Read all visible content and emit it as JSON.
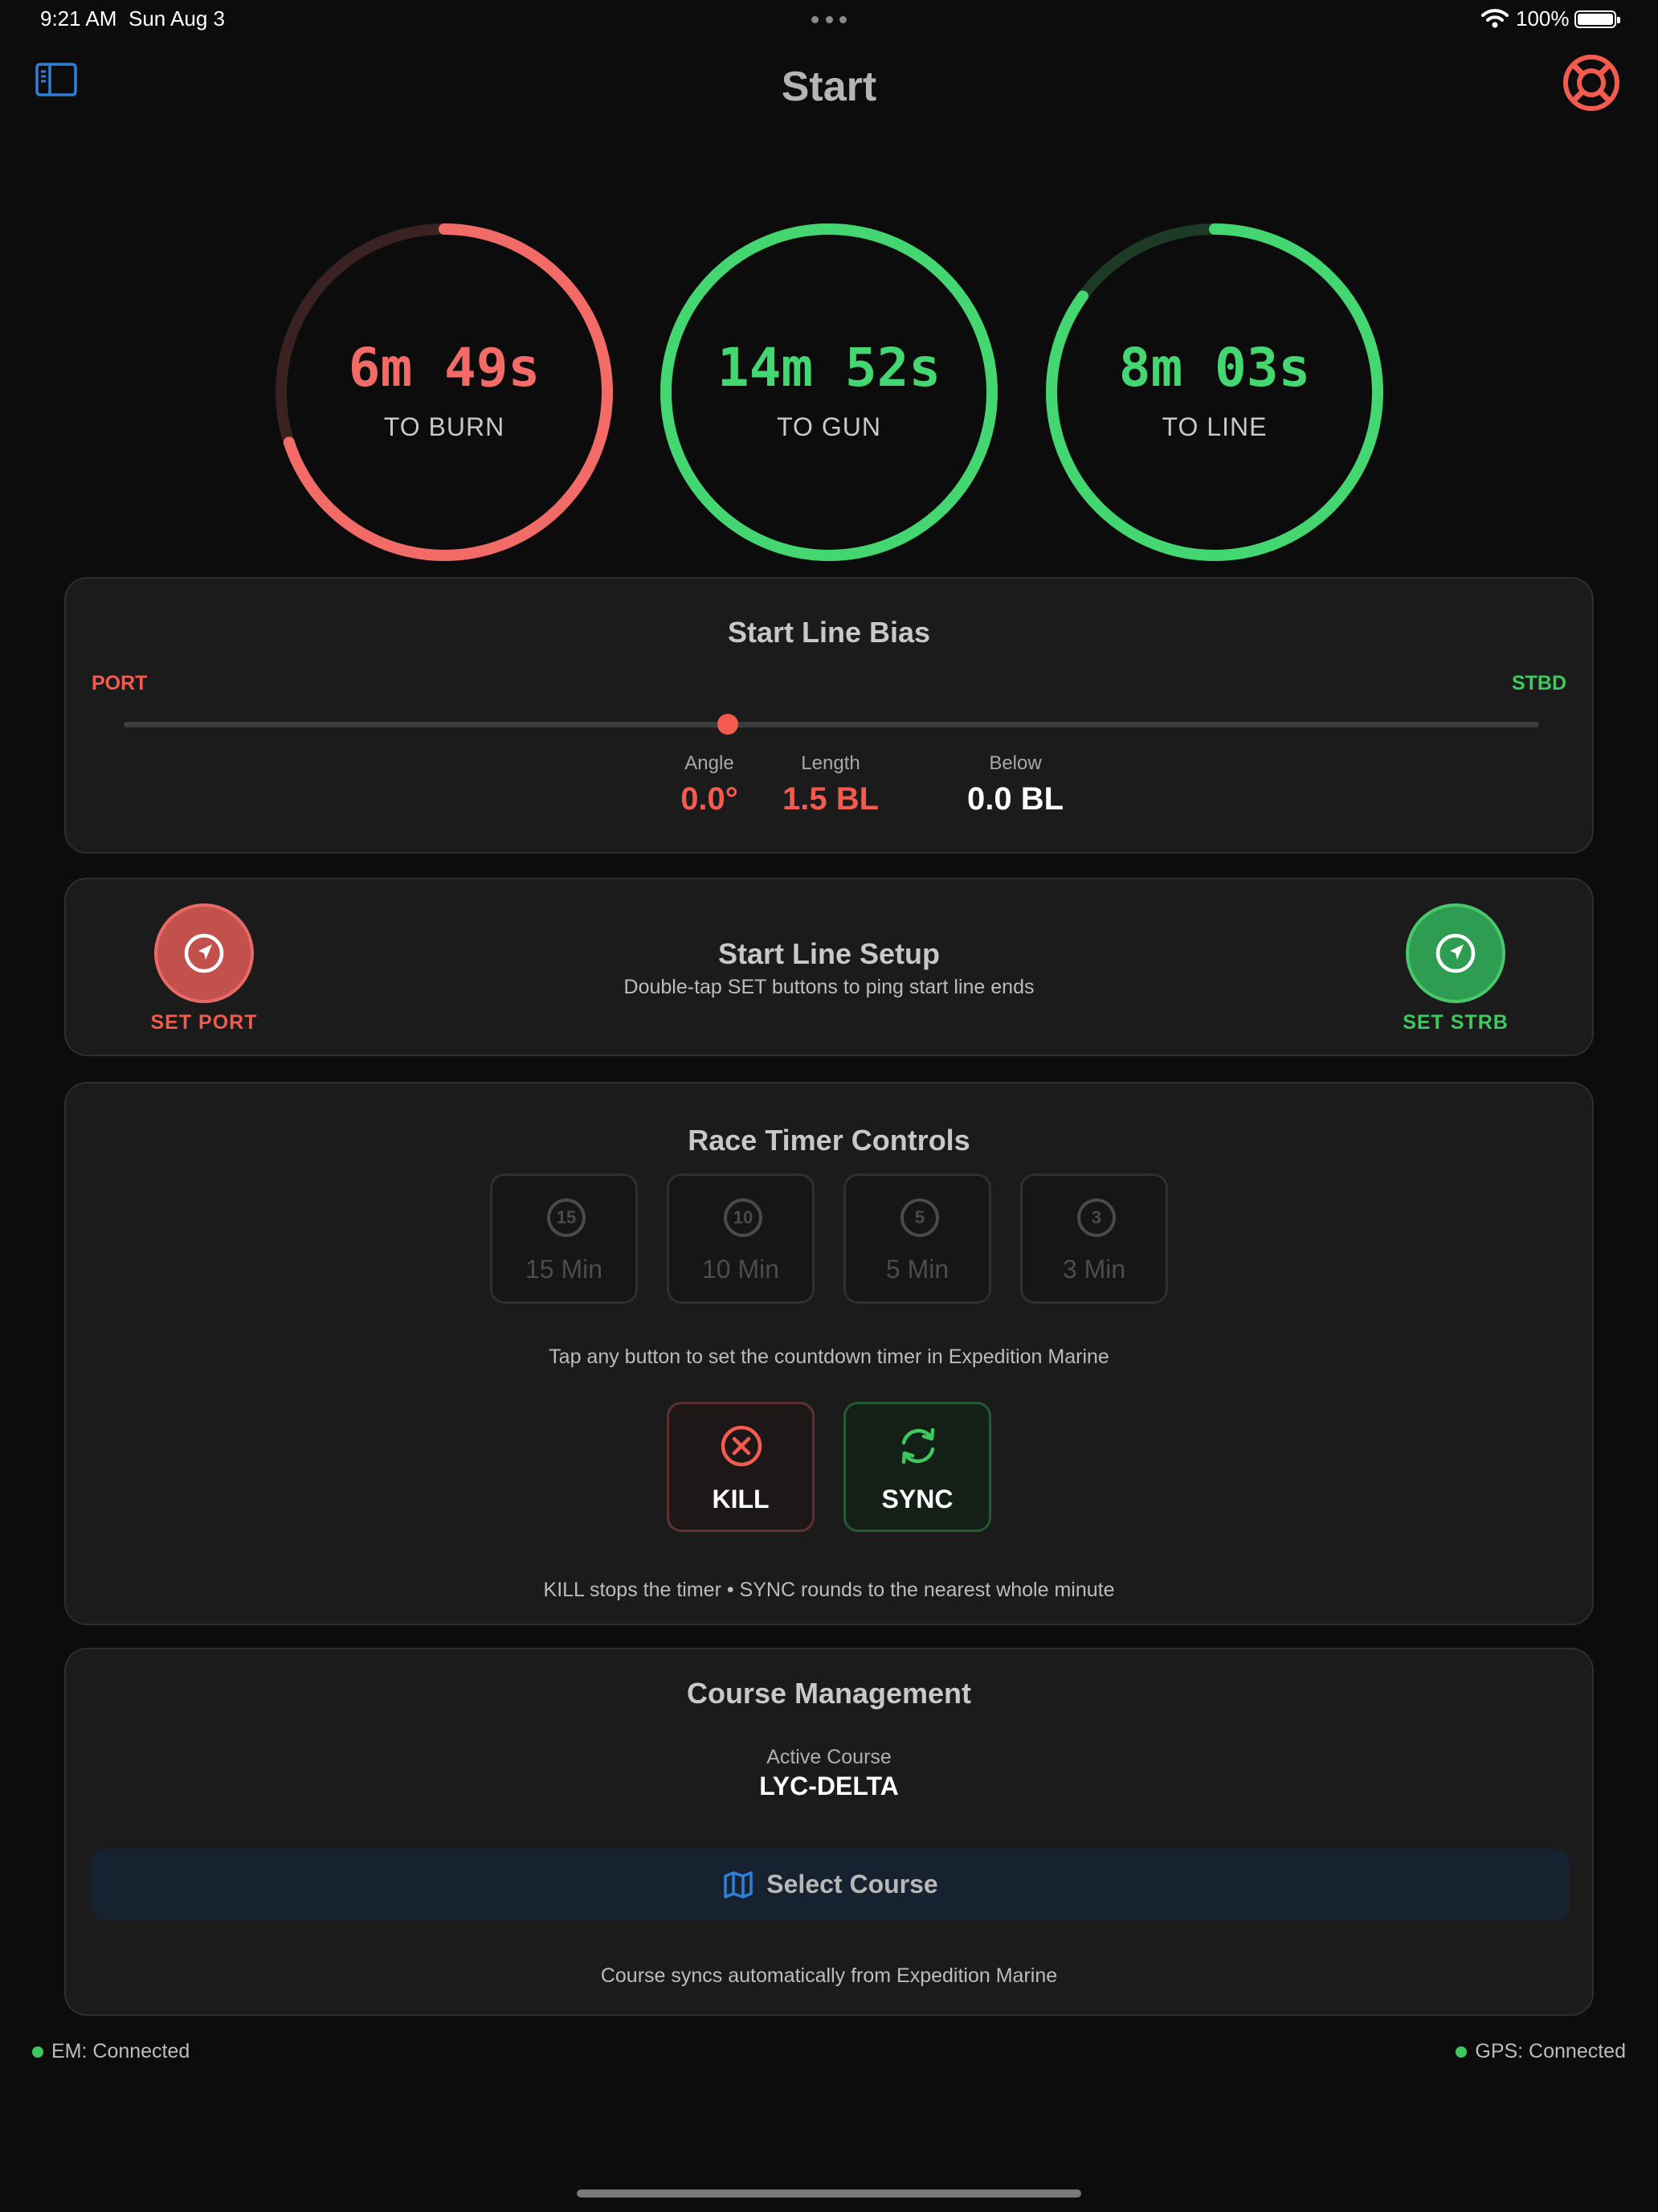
{
  "status_bar": {
    "time": "9:21 AM",
    "date": "Sun Aug 3",
    "battery": "100%"
  },
  "header": {
    "title": "Start"
  },
  "timers": [
    {
      "value": "6m 49s",
      "label": "TO BURN",
      "color": "#f26b66",
      "track_color": "#3a2122",
      "progress": 0.7
    },
    {
      "value": "14m 52s",
      "label": "TO GUN",
      "color": "#44d670",
      "track_color": "#1c3a25",
      "progress": 1.0
    },
    {
      "value": "8m 03s",
      "label": "TO LINE",
      "color": "#44d670",
      "track_color": "#1c3a25",
      "progress": 0.85
    }
  ],
  "bias": {
    "title": "Start Line Bias",
    "port_label": "PORT",
    "stbd_label": "STBD",
    "position": 0.427,
    "angle_label": "Angle",
    "angle_value": "0.0°",
    "length_label": "Length",
    "length_value": "1.5 BL",
    "below_label": "Below",
    "below_value": "0.0 BL"
  },
  "setup": {
    "title": "Start Line Setup",
    "subtitle": "Double-tap SET buttons to ping start line ends",
    "port_button": "SET PORT",
    "stbd_button": "SET STRB"
  },
  "timer_controls": {
    "title": "Race Timer Controls",
    "buttons": [
      {
        "icon": "15",
        "label": "15 Min"
      },
      {
        "icon": "10",
        "label": "10 Min"
      },
      {
        "icon": "5",
        "label": "5 Min"
      },
      {
        "icon": "3",
        "label": "3 Min"
      }
    ],
    "help": "Tap any button to set the countdown timer in Expedition Marine",
    "kill_label": "KILL",
    "sync_label": "SYNC",
    "footer": "KILL stops the timer • SYNC rounds to the nearest whole minute"
  },
  "course": {
    "title": "Course Management",
    "active_label": "Active Course",
    "active_value": "LYC-DELTA",
    "select_label": "Select Course",
    "footer": "Course syncs automatically from Expedition Marine"
  },
  "connections": {
    "em": "EM: Connected",
    "gps": "GPS: Connected"
  },
  "colors": {
    "accent_red": "#f25b4d",
    "accent_green": "#3ec95f",
    "accent_blue": "#2f7fd8"
  }
}
